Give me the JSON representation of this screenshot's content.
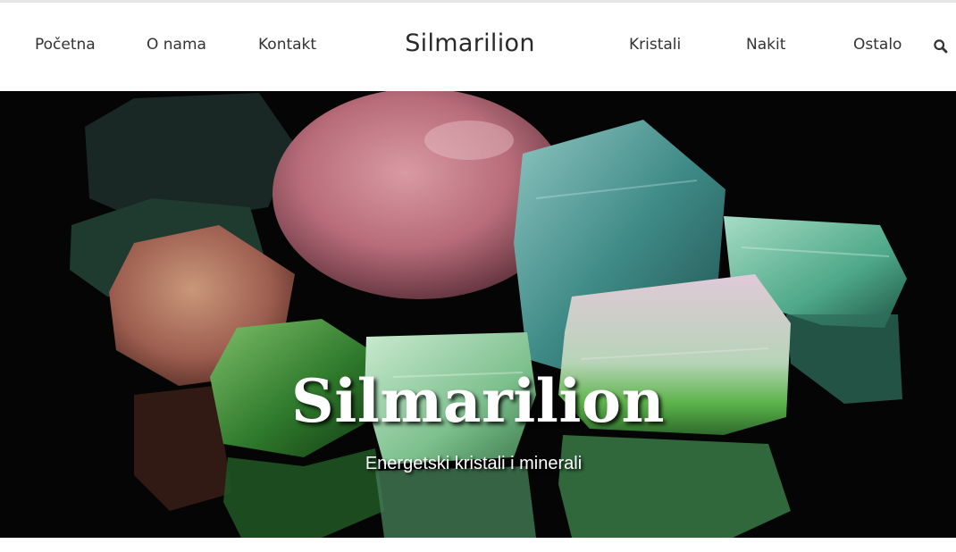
{
  "nav": {
    "left": [
      {
        "label": "Početna"
      },
      {
        "label": "O nama"
      },
      {
        "label": "Kontakt"
      }
    ],
    "brand": "Silmarilion",
    "right": [
      {
        "label": "Kristali"
      },
      {
        "label": "Nakit"
      },
      {
        "label": "Ostalo"
      }
    ],
    "search_icon": "search-icon"
  },
  "hero": {
    "title": "Silmarilion",
    "subtitle": "Energetski kristali i minerali",
    "image": "photo of tourmaline crystals (pink, green, blue) on black reflective surface"
  },
  "colors": {
    "nav_text": "#333333",
    "hero_background": "#050505",
    "hero_text": "#ffffff"
  }
}
